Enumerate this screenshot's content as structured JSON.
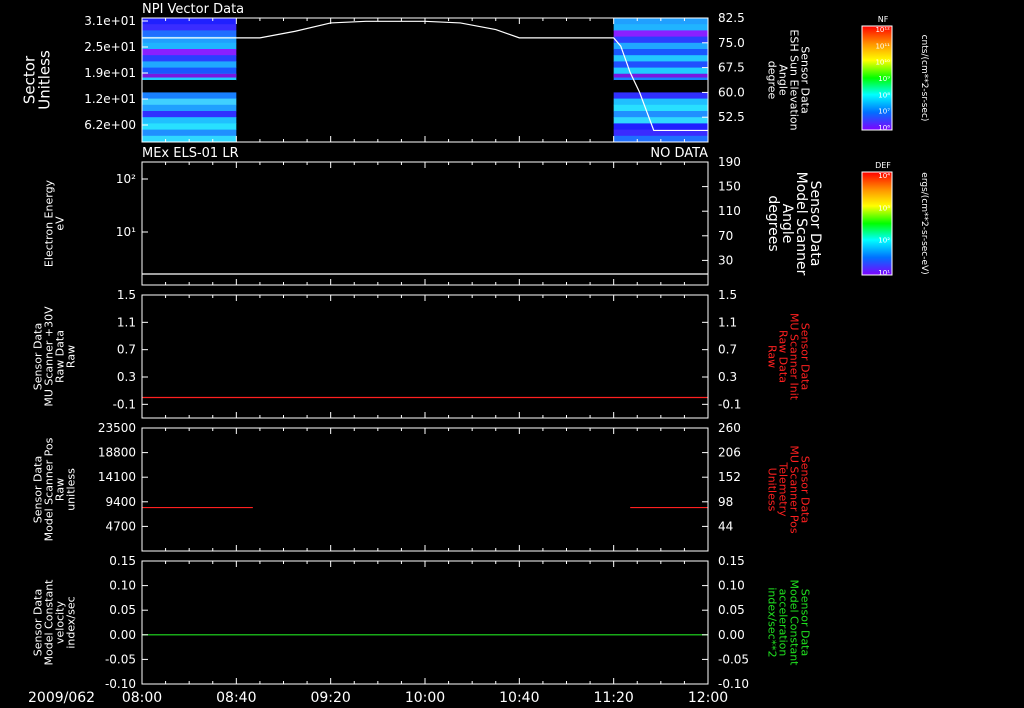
{
  "colors": {
    "background": "#000000",
    "axis": "#ffffff",
    "red": "#ff2020",
    "green": "#20e020"
  },
  "chart_data": [
    {
      "type": "heatmap",
      "title": "NPI Vector Data",
      "ylabel_lines": [
        "Sector",
        "Unitless"
      ],
      "yticks": [
        "3.1e+01",
        "2.5e+01",
        "1.9e+01",
        "1.2e+01",
        "6.2e+00"
      ],
      "y2label_lines": [
        "Sensor Data",
        "ESH Sun Elevation",
        "Angle",
        "degree"
      ],
      "y2ticks": [
        "82.5",
        "75.0",
        "67.5",
        "60.0",
        "52.5"
      ],
      "y2lim": [
        45,
        82.5
      ],
      "xlim": [
        "08:00",
        "12:00"
      ],
      "data_segments": [
        [
          "08:00",
          "08:40"
        ],
        [
          "11:20",
          "12:00"
        ]
      ],
      "line_series": {
        "name": "ESH Sun Elevation Angle",
        "color": "#ffffff",
        "x": [
          "08:00",
          "08:40",
          "08:50",
          "09:05",
          "09:20",
          "09:35",
          "10:00",
          "10:15",
          "10:30",
          "10:40",
          "10:50",
          "11:20",
          "11:23",
          "11:27",
          "11:31",
          "11:37",
          "12:00"
        ],
        "y": [
          76.5,
          76.5,
          76.5,
          78.5,
          81.0,
          81.5,
          81.5,
          81.0,
          79.0,
          76.5,
          76.5,
          76.5,
          74.0,
          66.0,
          60.0,
          48.5,
          48.5
        ]
      },
      "colorbar": {
        "title": "NF",
        "label": "cnts/(cm**2-sr-sec)",
        "ticks": [
          "10¹²",
          "10¹¹",
          "10¹⁰",
          "10⁹",
          "10⁸",
          "10⁷",
          "10⁶"
        ]
      }
    },
    {
      "type": "line",
      "title": "MEx ELS-01 LR",
      "status": "NO DATA",
      "ylabel_lines": [
        "Electron Energy",
        "eV"
      ],
      "yticks": [
        "10²",
        "10¹"
      ],
      "y_scale": "log",
      "y2label_lines": [
        "Sensor Data",
        "Model Scanner",
        "Angle",
        "degrees"
      ],
      "y2ticks": [
        "190",
        "150",
        "110",
        "70",
        "30"
      ],
      "y2lim": [
        10,
        190
      ],
      "series": [
        {
          "color": "#ffffff",
          "x": [
            "08:00",
            "12:00"
          ],
          "y": [
            10,
            10
          ]
        }
      ],
      "colorbar": {
        "title": "DEF",
        "label": "ergs/(cm**2-sr-sec-eV)",
        "ticks": [
          "10⁴",
          "10³",
          "10²",
          "10¹"
        ]
      }
    },
    {
      "type": "line",
      "ylabel_lines": [
        "Sensor Data",
        "MU Scanner +30V",
        "Raw Data",
        "Raw"
      ],
      "yticks": [
        "1.5",
        "1.1",
        "0.7",
        "0.3",
        "-0.1"
      ],
      "ylim": [
        -0.3,
        1.5
      ],
      "y2label_lines": [
        "Sensor Data",
        "MU Scanner Init",
        "Raw Data",
        "Raw"
      ],
      "y2label_color": "#ff2020",
      "y2ticks": [
        "1.5",
        "1.1",
        "0.7",
        "0.3",
        "-0.1"
      ],
      "series": [
        {
          "color": "#ff2020",
          "x": [
            "08:00",
            "12:00"
          ],
          "y": [
            0.0,
            0.0
          ]
        }
      ]
    },
    {
      "type": "line",
      "ylabel_lines": [
        "Sensor Data",
        "Model Scanner Pos",
        "Raw",
        "unitless"
      ],
      "yticks": [
        "23500",
        "18800",
        "14100",
        "9400",
        "4700"
      ],
      "ylim": [
        0,
        23500
      ],
      "y2label_lines": [
        "Sensor Data",
        "MU Scanner Pos",
        "Telemetry",
        "Unitless"
      ],
      "y2label_color": "#ff2020",
      "y2ticks": [
        "260",
        "206",
        "152",
        "98",
        "44"
      ],
      "series": [
        {
          "color": "#ff2020",
          "x": [
            "08:00",
            "08:47"
          ],
          "y": [
            8300,
            8300
          ]
        },
        {
          "color": "#ff2020",
          "x": [
            "11:27",
            "12:00"
          ],
          "y": [
            8300,
            8300
          ]
        }
      ]
    },
    {
      "type": "line",
      "ylabel_lines": [
        "Sensor Data",
        "Model Constant",
        "velocity",
        "index/sec"
      ],
      "yticks": [
        "0.15",
        "0.10",
        "0.05",
        "0.00",
        "-0.05",
        "-0.10"
      ],
      "ylim": [
        -0.1,
        0.15
      ],
      "y2label_lines": [
        "Sensor Data",
        "Model Constant",
        "acceleration",
        "index/sec**2"
      ],
      "y2label_color": "#20e020",
      "y2ticks": [
        "0.15",
        "0.10",
        "0.05",
        "0.00",
        "-0.05",
        "-0.10"
      ],
      "series": [
        {
          "color": "#20e020",
          "x": [
            "08:00",
            "12:00"
          ],
          "y": [
            0.0,
            0.0
          ]
        }
      ]
    }
  ],
  "xaxis": {
    "date_label": "2009/062",
    "ticks": [
      "08:00",
      "08:40",
      "09:20",
      "10:00",
      "10:40",
      "11:20",
      "12:00"
    ]
  }
}
